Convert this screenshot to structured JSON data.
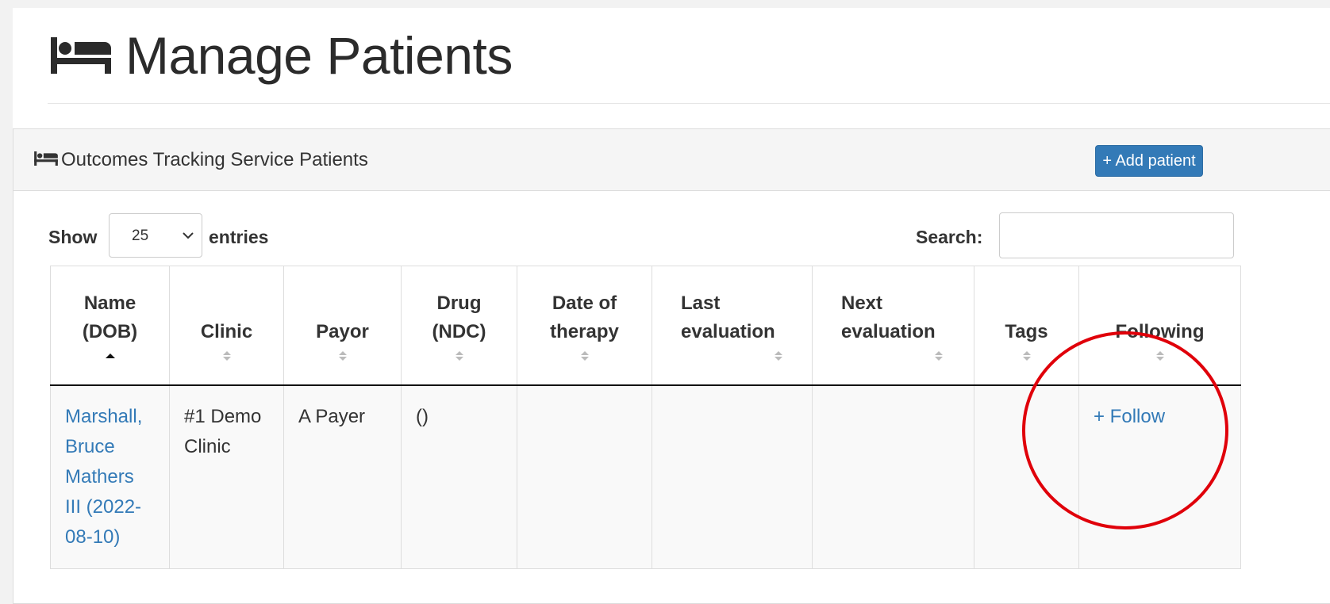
{
  "page": {
    "title": "Manage Patients",
    "icon": "bed-icon"
  },
  "panel": {
    "title": "Outcomes Tracking Service Patients",
    "icon": "bed-icon",
    "add_button_label": "+ Add patient"
  },
  "controls": {
    "show_label": "Show",
    "entries_value": "25",
    "entries_label": "entries",
    "search_label": "Search:",
    "search_value": ""
  },
  "table": {
    "columns": [
      {
        "line1": "Name",
        "line2": "(DOB)",
        "sort": "asc"
      },
      {
        "line1": "",
        "line2": "Clinic",
        "sort": "both"
      },
      {
        "line1": "",
        "line2": "Payor",
        "sort": "both"
      },
      {
        "line1": "Drug",
        "line2": "(NDC)",
        "sort": "both"
      },
      {
        "line1": "Date of",
        "line2": "therapy",
        "sort": "both"
      },
      {
        "line1": "Last",
        "line2": "evaluation",
        "sort": "both"
      },
      {
        "line1": "Next",
        "line2": "evaluation",
        "sort": "both"
      },
      {
        "line1": "",
        "line2": "Tags",
        "sort": "both"
      },
      {
        "line1": "",
        "line2": "Following",
        "sort": "both"
      }
    ],
    "rows": [
      {
        "name": "Marshall, Bruce Mathers III (2022-08-10)",
        "clinic": "#1 Demo Clinic",
        "payor": "A Payer",
        "drug": "()",
        "date_of_therapy": "",
        "last_evaluation": "",
        "next_evaluation": "",
        "tags": "",
        "following": "+ Follow"
      }
    ]
  },
  "colors": {
    "link": "#337ab7",
    "primary_button": "#337ab7",
    "annotation_circle": "#e0000a"
  }
}
